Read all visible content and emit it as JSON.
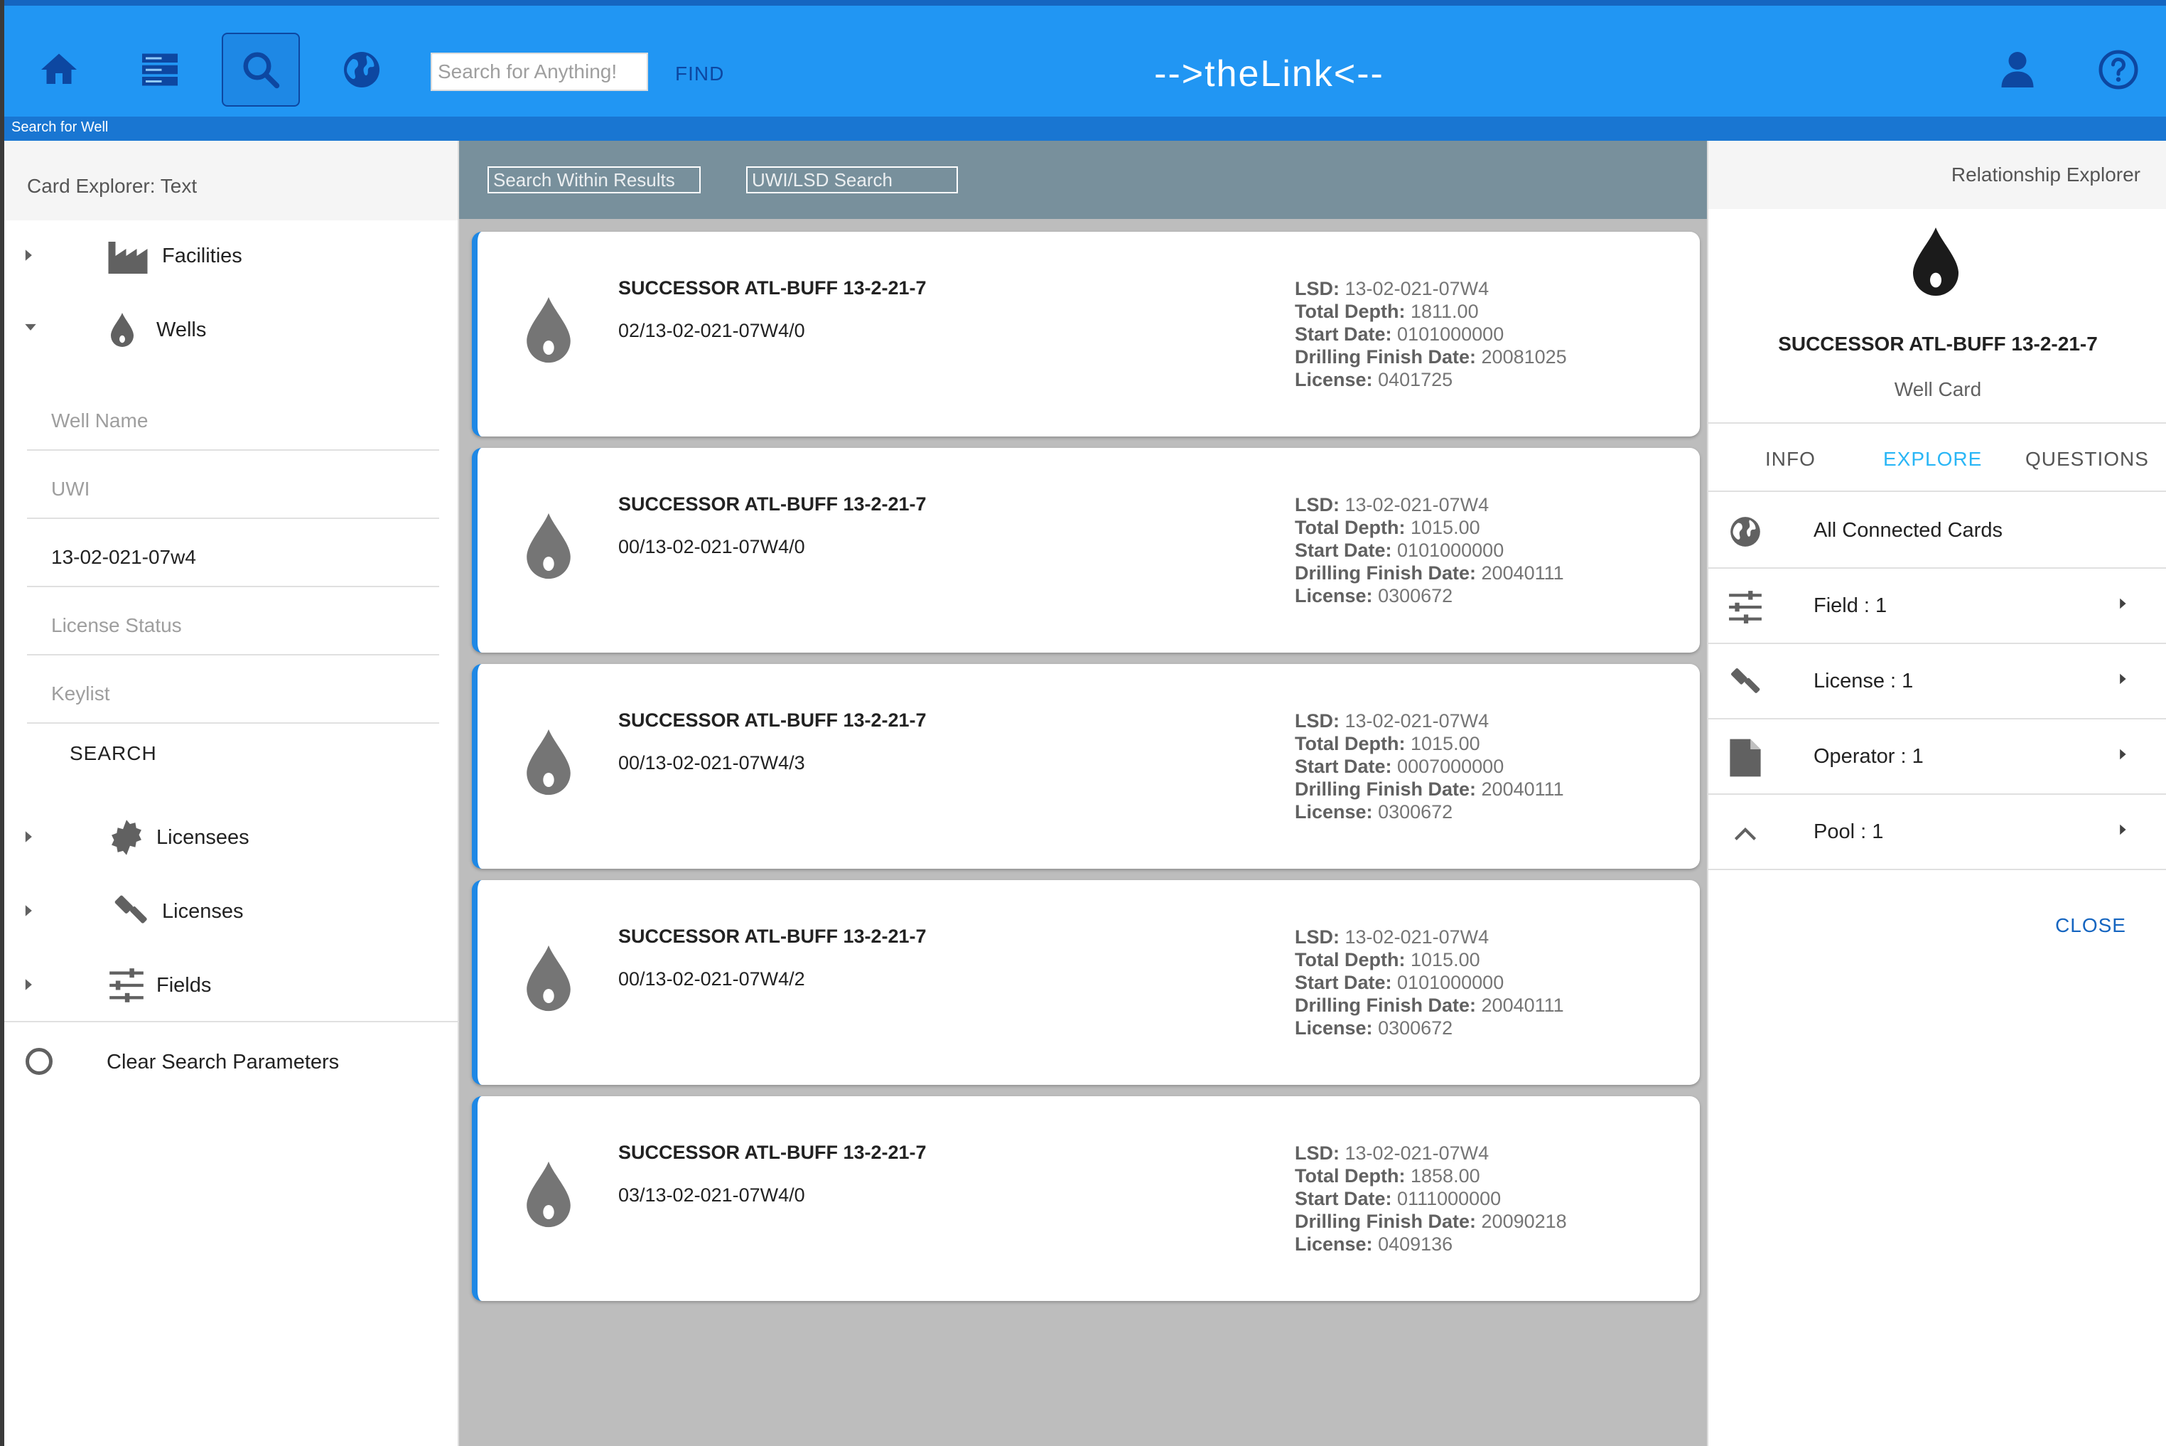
{
  "header": {
    "search_placeholder": "Search for Anything!",
    "find_label": "FIND",
    "brand": "-->theLink<--",
    "subbar_label": "Search for Well",
    "accent": "#2196f3"
  },
  "left_panel": {
    "title": "Card Explorer: Text",
    "tree": [
      {
        "label": "Facilities",
        "icon": "factory-icon",
        "expanded": false
      },
      {
        "label": "Wells",
        "icon": "water-drop-icon",
        "expanded": true
      },
      {
        "label": "Licensees",
        "icon": "badge-icon",
        "expanded": false
      },
      {
        "label": "Licenses",
        "icon": "gavel-icon",
        "expanded": false
      },
      {
        "label": "Fields",
        "icon": "sliders-icon",
        "expanded": false
      }
    ],
    "fields": [
      {
        "placeholder": "Well Name",
        "value": ""
      },
      {
        "placeholder": "UWI",
        "value": ""
      },
      {
        "placeholder": "",
        "value": "13-02-021-07w4"
      },
      {
        "placeholder": "License Status",
        "value": ""
      },
      {
        "placeholder": "Keylist",
        "value": ""
      }
    ],
    "search_label": "SEARCH",
    "clear_label": "Clear Search Parameters"
  },
  "results": {
    "search_within_placeholder": "Search Within Results",
    "uwi_search_placeholder": "UWI/LSD Search",
    "labels": {
      "lsd": "LSD:",
      "total_depth": "Total Depth:",
      "start_date": "Start Date:",
      "finish_date": "Drilling Finish Date:",
      "license": "License:"
    },
    "cards": [
      {
        "title": "SUCCESSOR ATL-BUFF 13-2-21-7",
        "uwi": "02/13-02-021-07W4/0",
        "lsd": "13-02-021-07W4",
        "total_depth": "1811.00",
        "start_date": "0101000000",
        "finish_date": "20081025",
        "license": "0401725"
      },
      {
        "title": "SUCCESSOR ATL-BUFF 13-2-21-7",
        "uwi": "00/13-02-021-07W4/0",
        "lsd": "13-02-021-07W4",
        "total_depth": "1015.00",
        "start_date": "0101000000",
        "finish_date": "20040111",
        "license": "0300672"
      },
      {
        "title": "SUCCESSOR ATL-BUFF 13-2-21-7",
        "uwi": "00/13-02-021-07W4/3",
        "lsd": "13-02-021-07W4",
        "total_depth": "1015.00",
        "start_date": "0007000000",
        "finish_date": "20040111",
        "license": "0300672"
      },
      {
        "title": "SUCCESSOR ATL-BUFF 13-2-21-7",
        "uwi": "00/13-02-021-07W4/2",
        "lsd": "13-02-021-07W4",
        "total_depth": "1015.00",
        "start_date": "0101000000",
        "finish_date": "20040111",
        "license": "0300672"
      },
      {
        "title": "SUCCESSOR ATL-BUFF 13-2-21-7",
        "uwi": "03/13-02-021-07W4/0",
        "lsd": "13-02-021-07W4",
        "total_depth": "1858.00",
        "start_date": "0111000000",
        "finish_date": "20090218",
        "license": "0409136"
      }
    ]
  },
  "relationship_explorer": {
    "title": "Relationship Explorer",
    "card_name": "SUCCESSOR ATL-BUFF 13-2-21-7",
    "card_type": "Well Card",
    "tabs": [
      "INFO",
      "EXPLORE",
      "QUESTIONS"
    ],
    "active_tab": "EXPLORE",
    "items": [
      {
        "label": "All Connected Cards",
        "icon": "globe-icon"
      },
      {
        "label": "Field : 1",
        "icon": "sliders-icon"
      },
      {
        "label": "License : 1",
        "icon": "gavel-icon"
      },
      {
        "label": "Operator : 1",
        "icon": "document-icon"
      },
      {
        "label": "Pool : 1",
        "icon": "chevron-up-icon"
      }
    ],
    "close_label": "CLOSE",
    "tab_active_color": "#29b6f6"
  }
}
